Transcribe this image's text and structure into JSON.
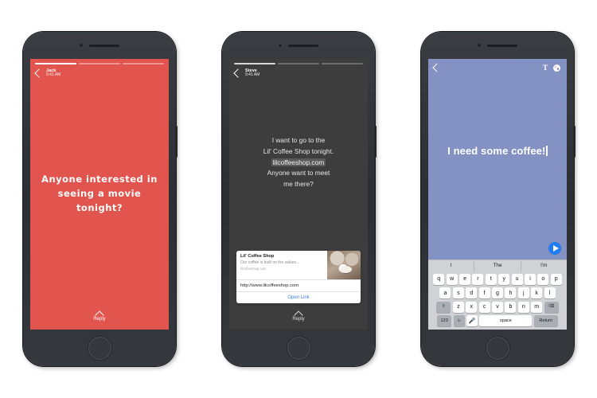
{
  "phones": {
    "story_red": {
      "sender": "Jack",
      "time": "9:41 AM",
      "message": "Anyone interested in seeing a movie tonight?",
      "reply_label": "Reply",
      "back_icon": "chevron-left-icon",
      "reply_icon": "caret-up-icon",
      "bg_color": "#e2554f",
      "progress_segments": 3,
      "progress_active": 1
    },
    "story_dark": {
      "sender": "Steve",
      "time": "9:41 AM",
      "message_line1": "I want to go to the",
      "message_line2": "Lil' Coffee Shop tonight.",
      "message_link": "lilcoffeeshop.com",
      "message_line3": "Anyone want to meet",
      "message_line4": "me there?",
      "reply_label": "Reply",
      "back_icon": "chevron-left-icon",
      "reply_icon": "caret-up-icon",
      "bg_color": "#3d3d3d",
      "progress_segments": 3,
      "progress_active": 1,
      "link_card": {
        "title": "Lil' Coffee Shop",
        "description": "Our coffee is built on the values...",
        "domain": "lilcoffeeshop.com",
        "url": "http://www.lilcoffeeshop.com",
        "open_label": "Open Link",
        "open_color": "#3b7fe0",
        "thumbnail_icon": "coffee-cup-image"
      }
    },
    "compose": {
      "back_icon": "chevron-left-icon",
      "text_tool_label": "T",
      "palette_icon": "color-palette-icon",
      "draft_text": "I need some coffee!",
      "send_icon": "send-paper-plane-icon",
      "send_color": "#1f7bf0",
      "bg_color": "#8491c3",
      "predictions": [
        "I",
        "The",
        "I'm"
      ],
      "keyboard": {
        "row1": [
          "q",
          "w",
          "e",
          "r",
          "t",
          "y",
          "u",
          "i",
          "o",
          "p"
        ],
        "row2": [
          "a",
          "s",
          "d",
          "f",
          "g",
          "h",
          "j",
          "k",
          "l"
        ],
        "row3_shift": "⇧",
        "row3": [
          "z",
          "x",
          "c",
          "v",
          "b",
          "n",
          "m"
        ],
        "row3_backspace": "⌫",
        "row4_numbers": "123",
        "row4_emoji": "☺",
        "row4_mic": "🎤",
        "row4_space": "space",
        "row4_return": "Return"
      }
    }
  }
}
